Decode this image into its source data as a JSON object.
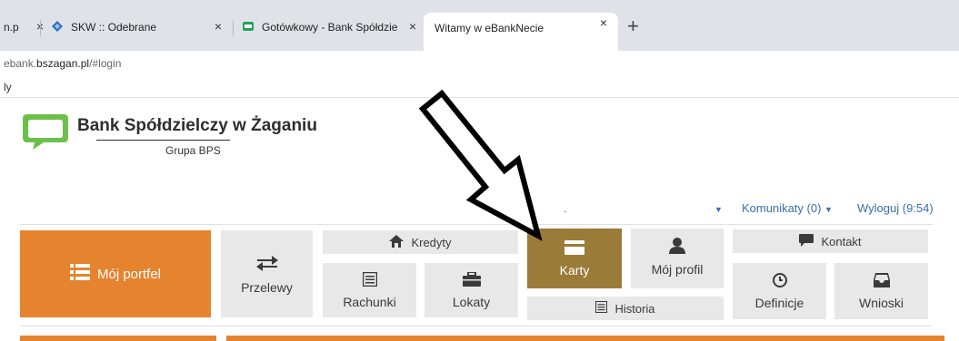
{
  "browser": {
    "tabs": [
      {
        "label": "n.p",
        "close": "×"
      },
      {
        "label": "SKW :: Odebrane",
        "close": "×"
      },
      {
        "label": "Gotówkowy - Bank Spółdzielczy",
        "close": "×"
      },
      {
        "label": "Witamy w eBankNecie",
        "close": "×",
        "active": true
      }
    ],
    "new_tab": "+",
    "url_prefix": "ebank.",
    "url_domain": "bszagan.pl",
    "url_path": "/#login",
    "bookmark": "ly"
  },
  "header": {
    "bank_name": "Bank Spółdzielczy w Żaganiu",
    "group": "Grupa BPS",
    "dot": ".",
    "messages": "Komunikaty (0)",
    "logout": "Wyloguj (9:54)"
  },
  "menu": {
    "portfolio": "Mój portfel",
    "transfers": "Przelewy",
    "credits": "Kredyty",
    "accounts": "Rachunki",
    "deposits": "Lokaty",
    "cards": "Karty",
    "history": "Historia",
    "profile": "Mój profil",
    "contact": "Kontakt",
    "definitions": "Definicje",
    "requests": "Wnioski"
  },
  "colors": {
    "orange": "#e5832e",
    "gold": "#9a7b38",
    "link": "#3a6fb0",
    "logo_green": "#6cc04a"
  }
}
